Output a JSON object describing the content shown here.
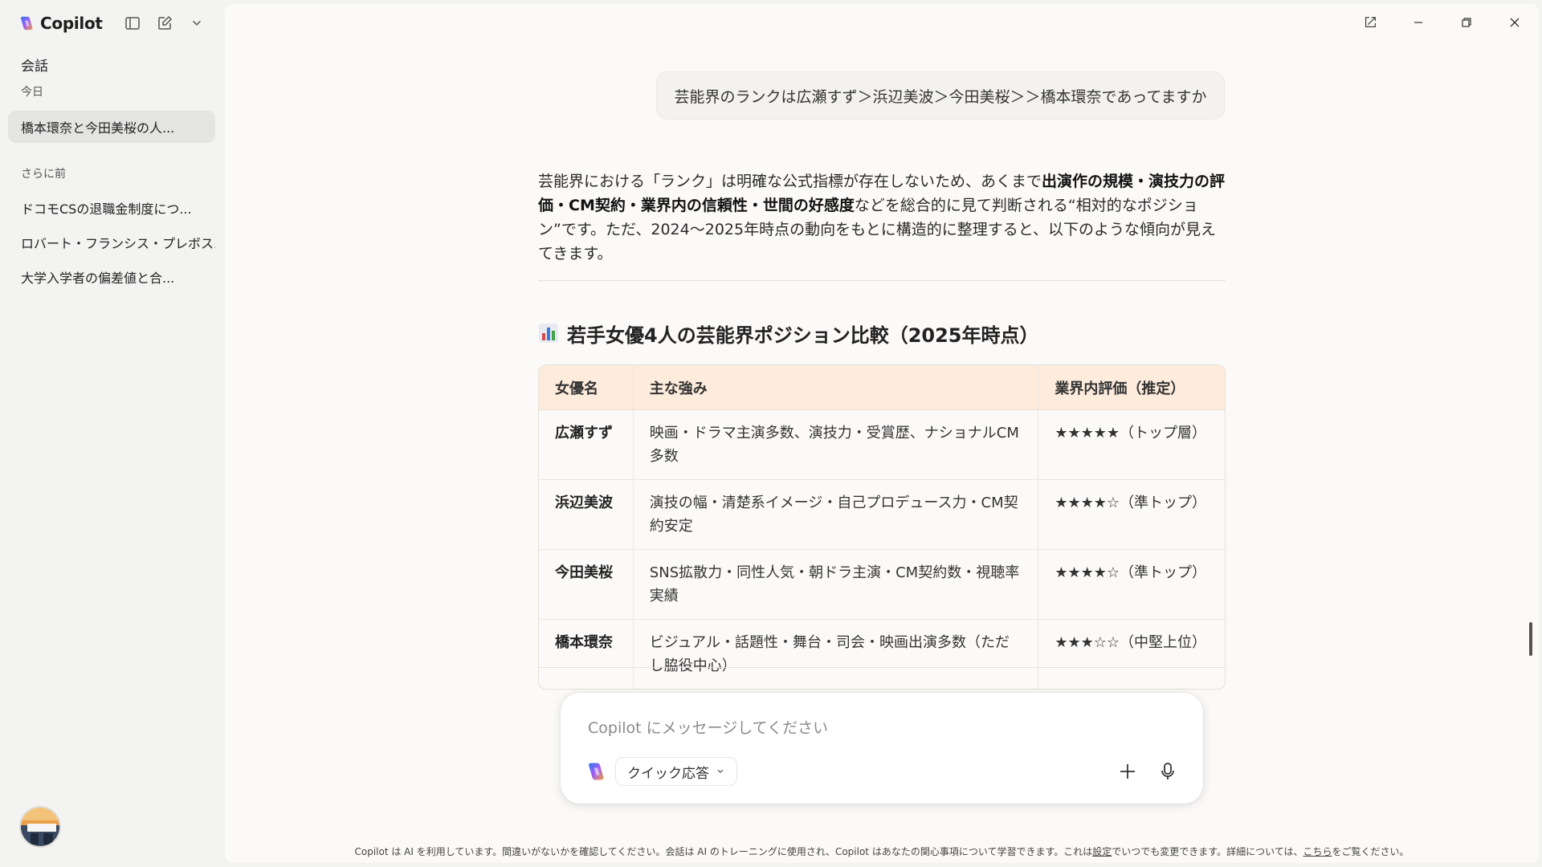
{
  "app": {
    "name": "Copilot"
  },
  "sidebar": {
    "section_title": "会話",
    "today_label": "今日",
    "earlier_label": "さらに前",
    "today_items": [
      {
        "label": "橋本環奈と今田美桜の人..."
      }
    ],
    "earlier_items": [
      {
        "label": "ドコモCSの退職金制度につ..."
      },
      {
        "label": "ロバート・フランシス・プレボス..."
      },
      {
        "label": "大学入学者の偏差値と合..."
      }
    ]
  },
  "chat": {
    "user_message": "芸能界のランクは広瀬すず＞浜辺美波＞今田美桜＞＞橋本環奈であってますか",
    "answer": {
      "p1": "芸能界における「ランク」は明確な公式指標が存在しないため、あくまで",
      "p1_bold1": "出演作の規模・演技力の評価・CM契約・業界内の信頼性・世間の好感度",
      "p1_rest": "などを総合的に見て判断される“相対的なポジション”です。ただ、2024〜2025年時点の動向をもとに構造的に整理すると、以下のような傾向が見えてきます。",
      "heading": "若手女優4人の芸能界ポジション比較（2025年時点）",
      "table": {
        "headers": [
          "女優名",
          "主な強み",
          "業界内評価（推定）"
        ],
        "rows": [
          [
            "広瀬すず",
            "映画・ドラマ主演多数、演技力・受賞歴、ナショナルCM多数",
            "★★★★★（トップ層）"
          ],
          [
            "浜辺美波",
            "演技の幅・清楚系イメージ・自己プロデュース力・CM契約安定",
            "★★★★☆（準トップ）"
          ],
          [
            "今田美桜",
            "SNS拡散力・同性人気・朝ドラ主演・CM契約数・視聴率実績",
            "★★★★☆（準トップ）"
          ],
          [
            "橋本環奈",
            "ビジュアル・話題性・舞台・司会・映画出演多数（ただし脇役中心）",
            "★★★☆☆（中堅上位）"
          ]
        ]
      }
    }
  },
  "composer": {
    "placeholder": "Copilot にメッセージしてください",
    "mode_label": "クイック応答"
  },
  "footer": {
    "text1": "Copilot は AI を利用しています。間違いがないかを確認してください。会話は AI のトレーニングに使用され、Copilot はあなたの関心事項について学習できます。これは",
    "link1": "設定",
    "text2": "でいつでも変更できます。詳細については、",
    "link2": "こちら",
    "text3": "をご覧ください。"
  },
  "colors": {
    "table_header_bg": "#fdebdc",
    "main_bg": "#fbfaf8",
    "sidebar_bg": "#f3f3f2"
  },
  "icons": [
    "copilot-logo-icon",
    "sidebar-toggle-icon",
    "new-chat-icon",
    "chevron-down-icon",
    "open-external-icon",
    "minimize-icon",
    "restore-icon",
    "close-icon",
    "bar-chart-icon",
    "plus-icon",
    "microphone-icon"
  ]
}
